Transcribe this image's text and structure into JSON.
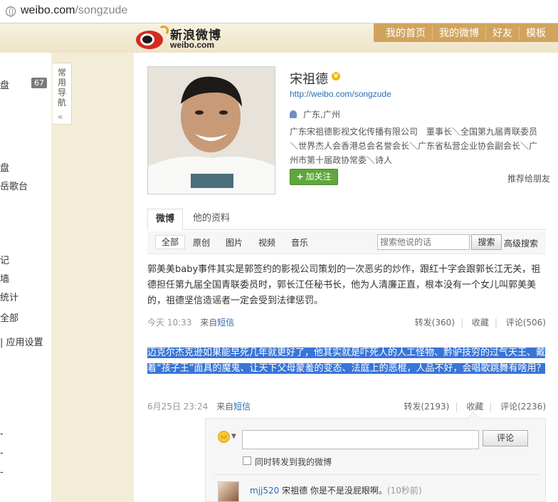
{
  "browser": {
    "url_domain": "weibo.com",
    "url_path": "/songzude"
  },
  "header": {
    "logo_cn": "新浪微博",
    "logo_en": "weibo.com",
    "nav": [
      "我的首页",
      "我的微博",
      "好友",
      "模板"
    ]
  },
  "sidebar": {
    "handle_label": "常用导航",
    "handle_chevron": "«",
    "items": [
      "盘",
      "盘",
      "岳歌台",
      "记",
      "墙",
      "统计",
      "全部",
      "| 应用设置",
      "-",
      "-",
      "-"
    ],
    "badge": "67"
  },
  "profile": {
    "name": "宋祖德",
    "verified": "V",
    "url": "http://weibo.com/songzude",
    "location": "广东,广州",
    "bio": "广东宋祖德影视文化传播有限公司　董事长＼全国第九届青联委员＼世界杰人会香港总会名誉会长＼广东省私营企业协会副会长＼广州市第十届政协常委＼诗人",
    "follow_label": "加关注",
    "recommend_label": "推荐给朋友"
  },
  "tabs": [
    "微博",
    "他的资料"
  ],
  "filters": [
    "全部",
    "原创",
    "图片",
    "视频",
    "音乐"
  ],
  "search": {
    "placeholder": "搜索他说的话",
    "button": "搜索",
    "advanced": "高级搜索"
  },
  "posts": [
    {
      "text": "郭美美baby事件其实是郭签约的影视公司策划的一次恶劣的炒作，跟红十字会跟郭长江无关，祖德担任第九届全国青联委员时，郭长江任秘书长，他为人清廉正直，根本没有一个女儿叫郭美美的，祖德坚信造谣者一定会受到法律惩罚。",
      "time": "今天 10:33",
      "source_prefix": "来自",
      "source": "短信",
      "repost": "转发(360)",
      "fav": "收藏",
      "comment": "评论(506)"
    },
    {
      "text": "迈克尔杰克逊如果能早死几年就更好了，他其实就是吓死人的人工怪物、黔驴技穷的过气天王、戴着“孩子王”面具的魔鬼、让天下父母蒙羞的变态、法庭上的恶棍，人品不好，会唱歌跳舞有啥用？",
      "time": "6月25日 23:24",
      "source_prefix": "来自",
      "source": "短信",
      "repost": "转发(2193)",
      "fav": "收藏",
      "comment": "评论(2236)"
    }
  ],
  "comment_box": {
    "button": "评论",
    "also_repost": "同时转发到我的微博",
    "comment": {
      "user": "mjj520",
      "text": "宋祖德 你是不是没屁眼啊。",
      "time": "(10秒前)"
    }
  },
  "colors": {
    "nav_bg": "#d1a45e",
    "follow_green": "#5ea73d",
    "link_blue": "#2a6db7",
    "selection_blue": "#3875d7"
  }
}
